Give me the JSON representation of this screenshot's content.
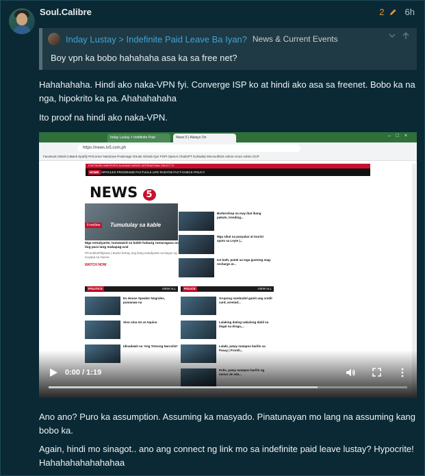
{
  "post": {
    "username": "Soul.Calibre",
    "edit_count": "2",
    "time": "6h"
  },
  "quote": {
    "topic_link": "Inday Lustay > Indefinite Paid Leave Ba Iyan?",
    "category": "News & Current Events",
    "text": "Boy vpn ka bobo hahahaha asa ka sa free net?"
  },
  "body": {
    "p1_line1": "Hahahahaha. Hindi ako naka-VPN fyi. Converge ISP ko at hindi ako asa sa freenet. Bobo ka na",
    "p1_line2": "nga, hipokrito ka pa. Ahahahahaha",
    "p2": "Ito proof na hindi ako naka-VPN.",
    "p3_line1": "Ano ano? Puro ka assumption. Assuming ka masyado. Pinatunayan mo lang na assuming kang",
    "p3_line2": "bobo ka.",
    "p4_line1": "Again, hindi mo sinagot.. ano ang connect ng link mo sa indefinite paid leave lustay? Hypocrite!",
    "p4_line2": "Hahahahahahahahaa"
  },
  "video": {
    "current_time": "0:00 / 1:19",
    "progress": 0,
    "buffered_fraction": 0.75
  },
  "screenshot": {
    "tabs": [
      "Inday Lustay > Indefinite Paid",
      "News 5 | Always On"
    ],
    "url": "https://news.tv5.com.ph",
    "bookmarks": "Facebook  GMail  CoBank  Spotify  PHCorner  NetsZone  Postimage  GSuite  GitHub  iQor PSPI  OpenAI  ChatGPT  GoDaddy  MicrosoftISS Admin  Azure Admin  GCP",
    "site_top": "5 NETWORK   ONESPORTS   ALAGANG KAPATID   INTERNATIONAL   SELECT TV",
    "site_nav_home": "HOME",
    "site_nav": "ARTICLES   PROGRAMS   FACTUALS   LIFE   RADYO5   FACT-CHECK POLICY",
    "logo_text": "NEWS",
    "logo_num": "5",
    "hero_caption": "Tumutulay sa kable",
    "hero_tag": "Frontline",
    "hero_title": "Mga estudyante, tumatawid sa kable habang rumaragasa ang ilog para lang makapag-aral",
    "hero_sub": "#FrontlinePilipinas | Buwis-buhay ang ilang estudyante sa bayan ng Koyapa sa Nueva",
    "watch_now": "WATCH NOW",
    "side_items": [
      "Barbershop na may ibat ibang pakulo, trending...",
      "Mga sikat na pasyalan at tourist spots sa Leyte |...",
      "Ice bath, patok sa mga gustong mag-recharge at..."
    ],
    "politics_head": "POLITICS",
    "police_head": "POLICE",
    "view_all": "VIEW ALL",
    "politics_items": [
      "Ex House Speaker Nograles, pumanaw na",
      "Sino nina Go at Aquino",
      "Idinadawit sa 'Ang Totoong Narcolist'"
    ],
    "police_items": [
      "Grupong nambudol gamit ang credit card, arestad...",
      "Lalaking dating nakulong dahil sa ilegal na droga,...",
      "Lalaki, patay matapos barilin sa Pasay | Frontli..."
    ],
    "bottom_item": "Pulis, patay matapos barilin ng menor de eda..."
  },
  "colors": {
    "background": "#0a2935",
    "link": "#3fa3d8",
    "accent_orange": "#e8913a",
    "news5_red": "#c8102e"
  }
}
